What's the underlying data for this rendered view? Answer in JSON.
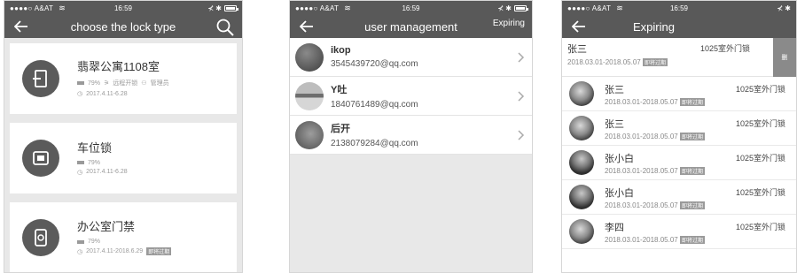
{
  "colors": {
    "header": "#595959",
    "background": "#e8e8e8",
    "card": "#ffffff",
    "tag": "#9a9a9a"
  },
  "status_bar": {
    "carrier": "●●●●○ A&AT",
    "time": "16:59",
    "right": "⊀ ✱"
  },
  "screen1": {
    "title": "choose the lock type",
    "locks": [
      {
        "name": "翡翠公寓1108室",
        "meta": [
          "79%",
          "远程开锁",
          "管理员"
        ],
        "dates": "2017.4.11-6.28",
        "icon": "door-lock-icon"
      },
      {
        "name": "车位锁",
        "meta": [
          "79%"
        ],
        "dates": "2017.4.11-6.28",
        "icon": "parking-lock-icon"
      },
      {
        "name": "办公室门禁",
        "meta": [
          "79%"
        ],
        "dates": "2017.4.11-2018.6.29",
        "tag": "即将过期",
        "icon": "access-control-icon"
      }
    ]
  },
  "screen2": {
    "title": "user management",
    "action": "Expiring",
    "users": [
      {
        "name": "ikop",
        "email": "3545439720@qq.com"
      },
      {
        "name": "Y吐",
        "email": "1840761489@qq.com"
      },
      {
        "name": "后开",
        "email": "2138079284@qq.com"
      }
    ]
  },
  "screen3": {
    "title": "Expiring",
    "first": {
      "name": "张三",
      "dates": "2018.03.01-2018.05.07",
      "tag": "即将过期",
      "location": "1025室外门锁",
      "swipe_action": "删"
    },
    "items": [
      {
        "name": "张三",
        "dates": "2018.03.01-2018.05.07",
        "tag": "即将过期",
        "location": "1025室外门锁"
      },
      {
        "name": "张三",
        "dates": "2018.03.01-2018.05.07",
        "tag": "即将过期",
        "location": "1025室外门锁"
      },
      {
        "name": "张小白",
        "dates": "2018.03.01-2018.05.07",
        "tag": "即将过期",
        "location": "1025室外门锁"
      },
      {
        "name": "张小白",
        "dates": "2018.03.01-2018.05.07",
        "tag": "即将过期",
        "location": "1025室外门锁"
      },
      {
        "name": "李四",
        "dates": "2018.03.01-2018.05.07",
        "tag": "即将过期",
        "location": "1025室外门锁"
      }
    ]
  }
}
